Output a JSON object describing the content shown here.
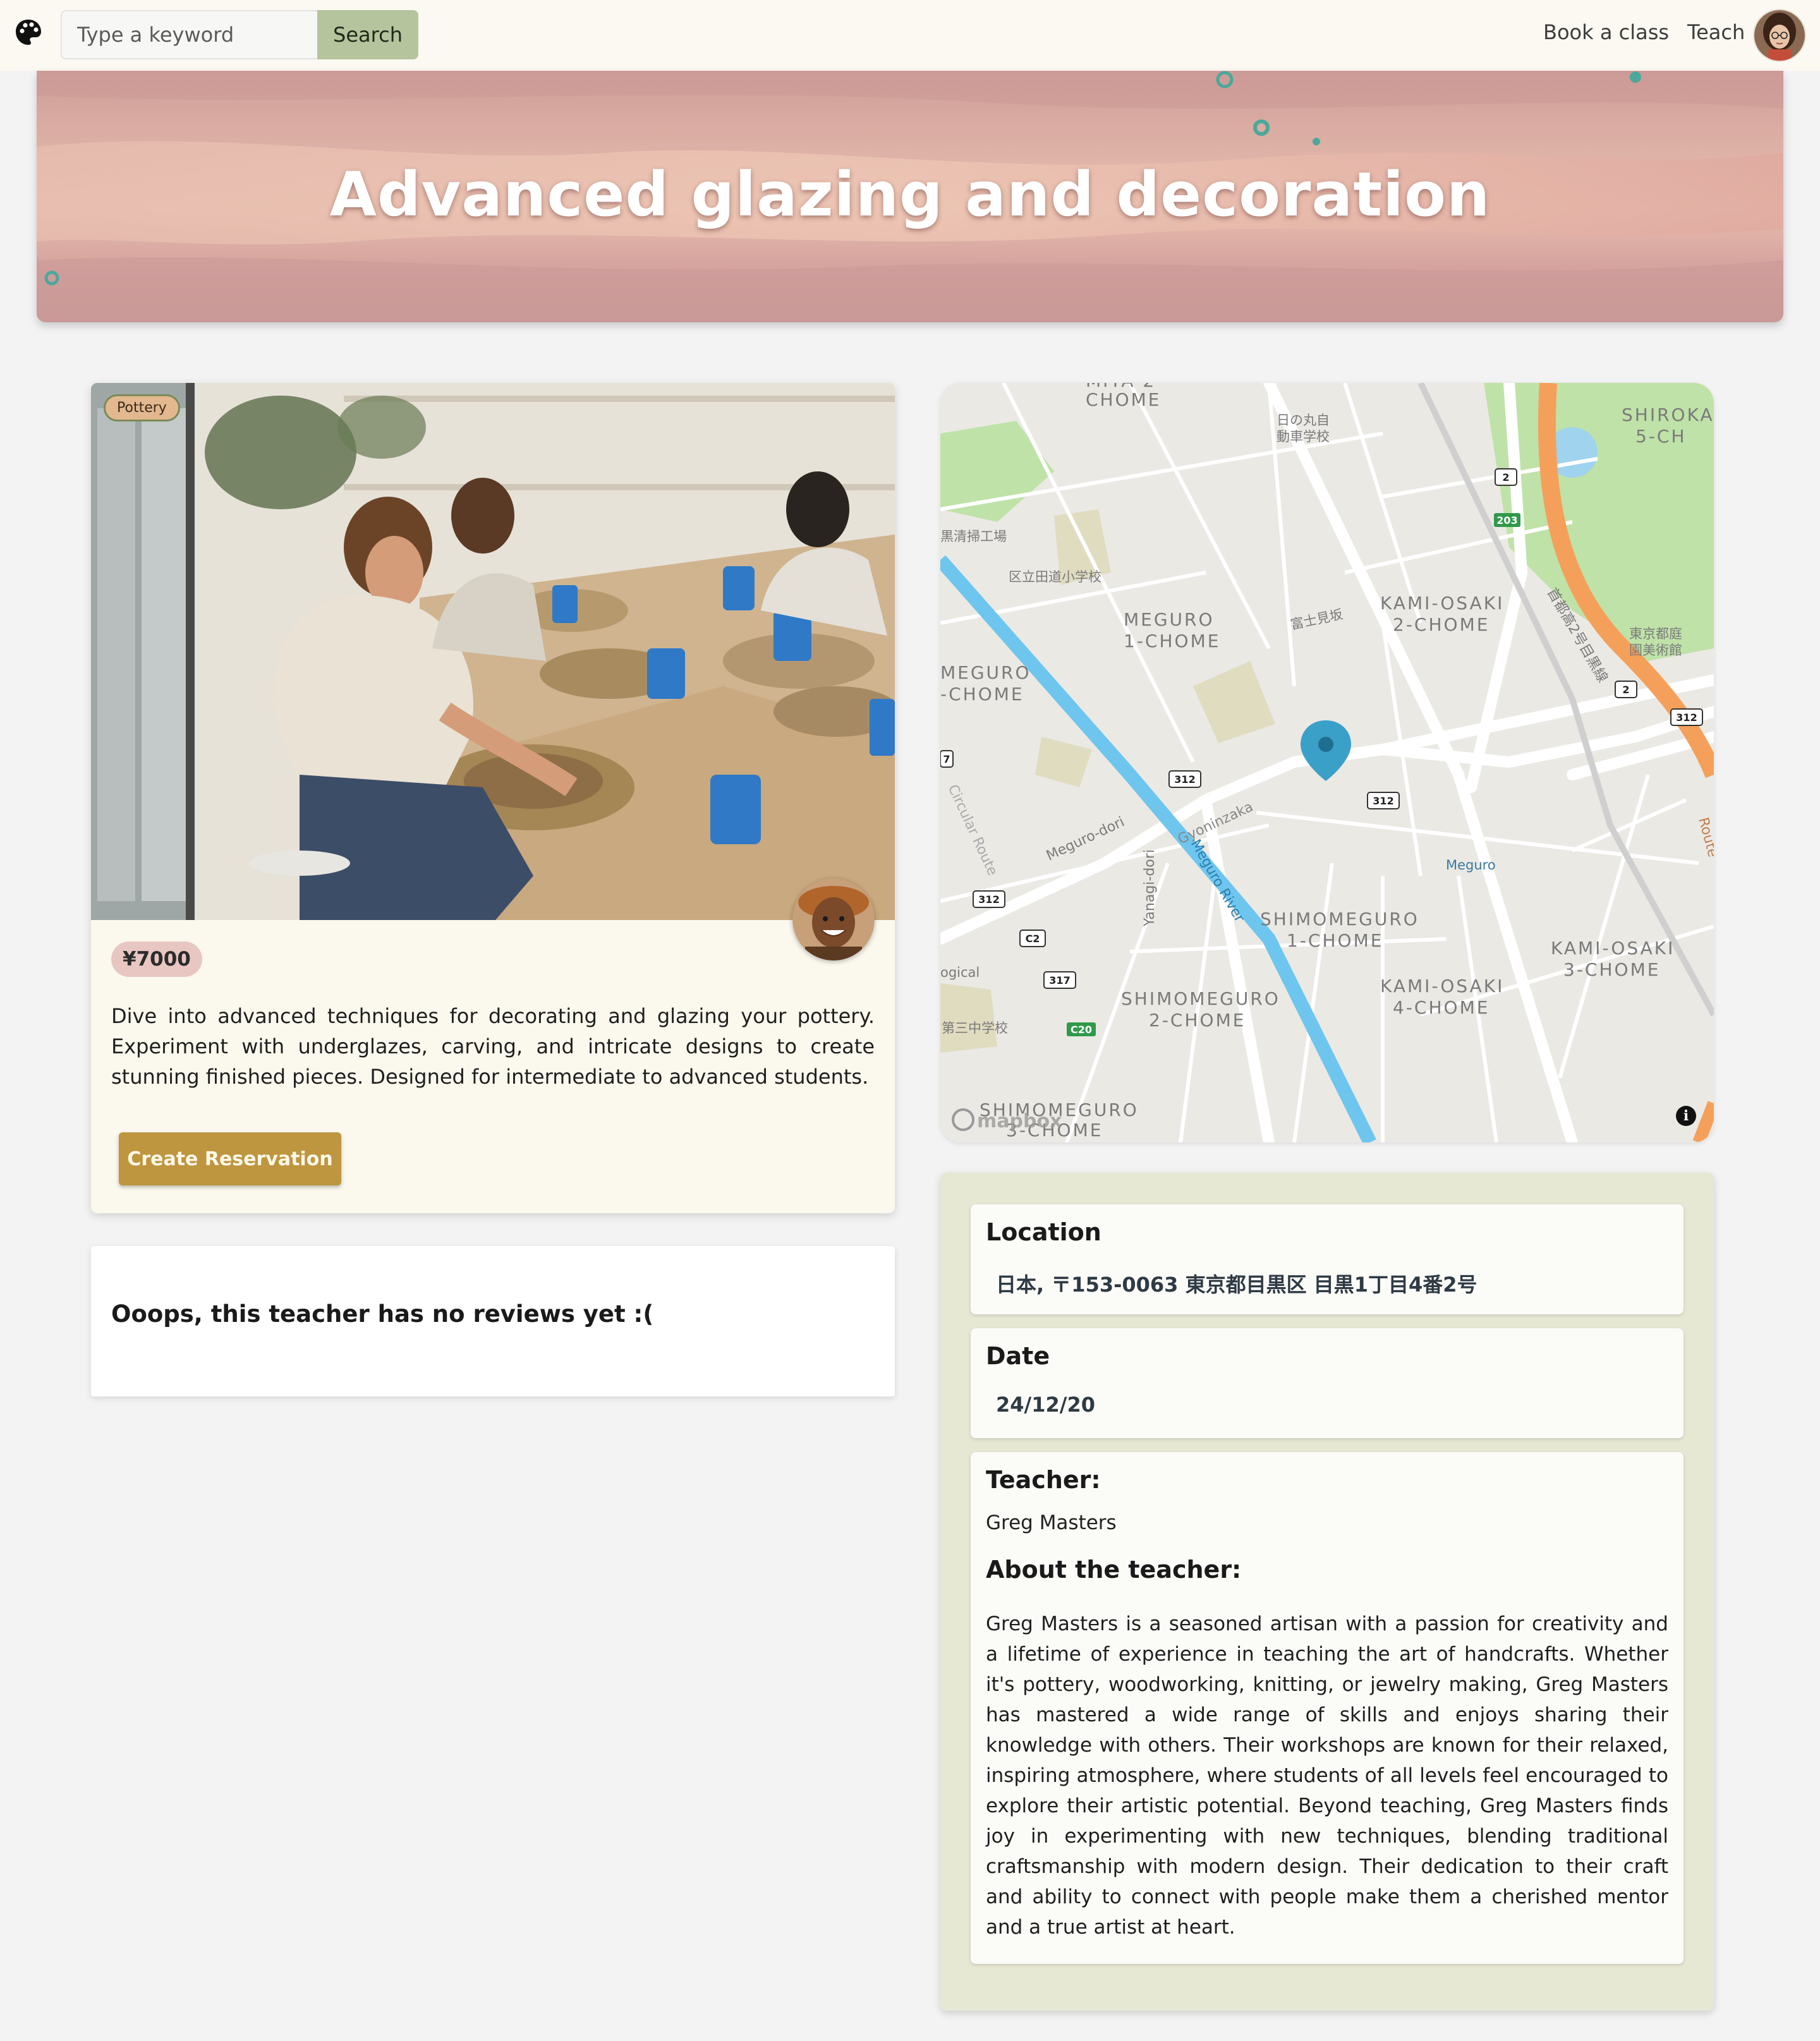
{
  "navbar": {
    "logo_icon": "palette-icon",
    "search_placeholder": "Type a keyword",
    "search_label": "Search",
    "links": [
      "Book a class",
      "Teach"
    ],
    "avatar_icon": "user-avatar"
  },
  "hero": {
    "title": "Advanced glazing and decoration"
  },
  "class": {
    "category": "Pottery",
    "price": "¥7000",
    "description": "Dive into advanced techniques for decorating and glazing your pottery. Experiment with underglazes, carving, and intricate designs to create stunning finished pieces. Designed for intermediate to advanced students.",
    "reserve_label": "Create Reservation"
  },
  "reviews": {
    "empty_message": "Ooops, this teacher has no reviews yet :("
  },
  "map": {
    "labels": {
      "miya2": "MIYA 2",
      "chome": "CHOME",
      "hinomaru": "日の丸自",
      "hinomaru2": "動車学校",
      "shiroka": "SHIROKA",
      "shiroka2": "5-CH",
      "seiso": "黒清掃工場",
      "tamichi": "区立田道小学校",
      "meguro1a": "MEGURO",
      "meguro1b": "1-CHOME",
      "fujimizaka": "富士見坂",
      "kamiosaki2a": "KAMI-OSAKI",
      "kamiosaki2b": "2-CHOME",
      "teien1": "東京都庭",
      "teien2": "園美術館",
      "meguro_left_a": "MEGURO",
      "meguro_left_b": "-CHOME",
      "shuto": "首都高2号目黒線",
      "meguro_dori": "Meguro-dori",
      "yanagi_dori": "Yanagi-dori",
      "meguro_river": "Meguro River",
      "gyoninzaka": "Gyoninzaka",
      "meguro_station": "Meguro",
      "circular": "Circular Route",
      "shimomeguro1a": "SHIMOMEGURO",
      "shimomeguro1b": "1-CHOME",
      "kamiosaki3a": "KAMI-OSAKI",
      "kamiosaki3b": "3-CHOME",
      "kamiosaki4a": "KAMI-OSAKI",
      "kamiosaki4b": "4-CHOME",
      "shimomeguro2a": "SHIMOMEGURO",
      "shimomeguro2b": "2-CHOME",
      "shimomeguro3a": "SHIMOMEGURO",
      "shimomeguro3b": "3-CHOME",
      "ogical": "ogical",
      "daisan": "第三中学校",
      "route": "Route",
      "mapbox": "mapbox"
    },
    "shields": {
      "r2a": "2",
      "r203": "203",
      "r2b": "2",
      "r312a": "312",
      "r312b": "312",
      "r312c": "312",
      "r312d": "312",
      "r7": "7",
      "rc2": "C2",
      "r317": "317",
      "rc20": "C20"
    },
    "info_label": "i"
  },
  "details": {
    "location_heading": "Location",
    "location_value": "日本, 〒153-0063 東京都目黒区 目黒1丁目4番2号",
    "date_heading": "Date",
    "date_value": "24/12/20",
    "teacher_heading": "Teacher:",
    "teacher_name": "Greg Masters",
    "about_heading": "About the teacher:",
    "about_text": "Greg Masters is a seasoned artisan with a passion for creativity and a lifetime of experience in teaching the art of handcrafts. Whether it's pottery, woodworking, knitting, or jewelry making, Greg Masters has mastered a wide range of skills and enjoys sharing their knowledge with others. Their workshops are known for their relaxed, inspiring atmosphere, where students of all levels feel encouraged to explore their artistic potential. Beyond teaching, Greg Masters finds joy in experimenting with new techniques, blending traditional craftsmanship with modern design. Their dedication to their craft and ability to connect with people make them a cherished mentor and a true artist at heart."
  },
  "colors": {
    "accent_button": "#be9640",
    "search_button": "#b5c49d",
    "details_panel": "#e7e8d4",
    "price_badge": "#e8c6c2"
  }
}
